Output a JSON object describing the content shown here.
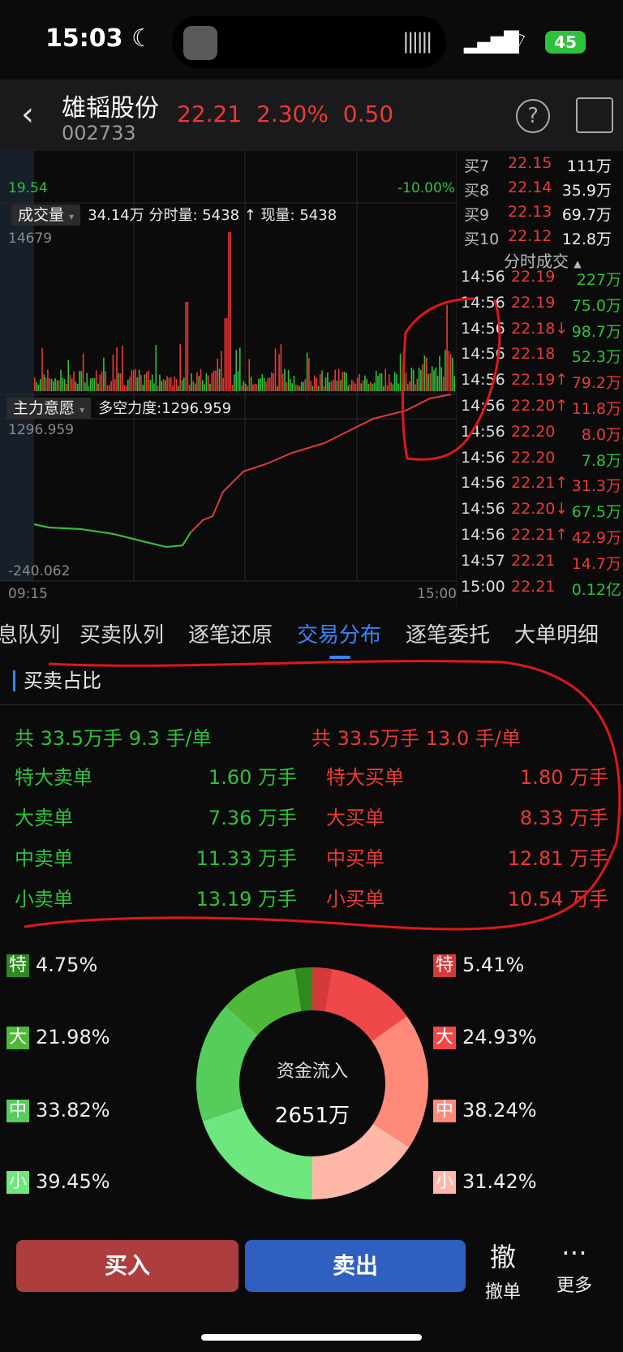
{
  "status_bar": {
    "time": "15:03",
    "battery": "45"
  },
  "header": {
    "name": "雄韬股份",
    "code": "002733",
    "price": "22.21",
    "change_pct": "2.30%",
    "change": "0.50"
  },
  "chart": {
    "top_left": "19.54",
    "top_right": "-10.00%",
    "volume_tag": "成交量",
    "volume_info": "34.14万 分时量: 5438 ↑ 现量: 5438",
    "volume_max": "14679",
    "force_tag": "主力意愿",
    "force_info": "多空力度:1296.959",
    "force_max": "1296.959",
    "force_min": "-240.062",
    "time_start": "09:15",
    "time_end": "15:00"
  },
  "order_book": [
    {
      "label": "买7",
      "price": "22.15",
      "vol": "111万"
    },
    {
      "label": "买8",
      "price": "22.14",
      "vol": "35.9万"
    },
    {
      "label": "买9",
      "price": "22.13",
      "vol": "69.7万"
    },
    {
      "label": "买10",
      "price": "22.12",
      "vol": "12.8万"
    }
  ],
  "trades_title": "分时成交",
  "trades": [
    {
      "time": "14:56",
      "price": "22.19",
      "vol": "227万",
      "pc": "red",
      "vc": "green"
    },
    {
      "time": "14:56",
      "price": "22.19",
      "vol": "75.0万",
      "pc": "red",
      "vc": "green"
    },
    {
      "time": "14:56",
      "price": "22.18↓",
      "vol": "98.7万",
      "pc": "red",
      "vc": "green"
    },
    {
      "time": "14:56",
      "price": "22.18",
      "vol": "52.3万",
      "pc": "red",
      "vc": "green"
    },
    {
      "time": "14:56",
      "price": "22.19↑",
      "vol": "79.2万",
      "pc": "red",
      "vc": "red"
    },
    {
      "time": "14:56",
      "price": "22.20↑",
      "vol": "11.8万",
      "pc": "red",
      "vc": "red"
    },
    {
      "time": "14:56",
      "price": "22.20",
      "vol": "8.0万",
      "pc": "red",
      "vc": "red"
    },
    {
      "time": "14:56",
      "price": "22.20",
      "vol": "7.8万",
      "pc": "red",
      "vc": "green"
    },
    {
      "time": "14:56",
      "price": "22.21↑",
      "vol": "31.3万",
      "pc": "red",
      "vc": "red"
    },
    {
      "time": "14:56",
      "price": "22.20↓",
      "vol": "67.5万",
      "pc": "red",
      "vc": "green"
    },
    {
      "time": "14:56",
      "price": "22.21↑",
      "vol": "42.9万",
      "pc": "red",
      "vc": "red"
    },
    {
      "time": "14:57",
      "price": "22.21",
      "vol": "14.7万",
      "pc": "red",
      "vc": "red"
    },
    {
      "time": "15:00",
      "price": "22.21",
      "vol": "0.12亿",
      "pc": "red",
      "vc": "green"
    }
  ],
  "tabs": [
    "息队列",
    "买卖队列",
    "逐笔还原",
    "交易分布",
    "逐笔委托",
    "大单明细"
  ],
  "active_tab": "交易分布",
  "section": {
    "title": "买卖占比",
    "sell_total": "共 33.5万手  9.3 手/单",
    "buy_total": "共 33.5万手  13.0 手/单",
    "rows": [
      {
        "sell_label": "特大卖单",
        "sell_val": "1.60 万手",
        "buy_label": "特大买单",
        "buy_val": "1.80 万手"
      },
      {
        "sell_label": "大卖单",
        "sell_val": "7.36 万手",
        "buy_label": "大买单",
        "buy_val": "8.33 万手"
      },
      {
        "sell_label": "中卖单",
        "sell_val": "11.33 万手",
        "buy_label": "中买单",
        "buy_val": "12.81 万手"
      },
      {
        "sell_label": "小卖单",
        "sell_val": "13.19 万手",
        "buy_label": "小买单",
        "buy_val": "10.54 万手"
      }
    ]
  },
  "donut": {
    "center_title": "资金流入",
    "center_value": "2651万",
    "sell": [
      {
        "tag": "特",
        "pct": "4.75%",
        "value": 4.75,
        "color": "#2c8a1f"
      },
      {
        "tag": "大",
        "pct": "21.98%",
        "value": 21.98,
        "color": "#4fb838"
      },
      {
        "tag": "中",
        "pct": "33.82%",
        "value": 33.82,
        "color": "#56cc5a"
      },
      {
        "tag": "小",
        "pct": "39.45%",
        "value": 39.45,
        "color": "#6ee87e"
      }
    ],
    "buy": [
      {
        "tag": "特",
        "pct": "5.41%",
        "value": 5.41,
        "color": "#d33b3b"
      },
      {
        "tag": "大",
        "pct": "24.93%",
        "value": 24.93,
        "color": "#f04848"
      },
      {
        "tag": "中",
        "pct": "38.24%",
        "value": 38.24,
        "color": "#ff8a7a"
      },
      {
        "tag": "小",
        "pct": "31.42%",
        "value": 31.42,
        "color": "#ffb8a8"
      }
    ]
  },
  "bottom": {
    "buy": "买入",
    "sell": "卖出",
    "cancel_icon": "撤",
    "cancel": "撤单",
    "more_icon": "⋯",
    "more": "更多"
  },
  "colors": {
    "up": "#ea3a36",
    "down": "#2ec23a",
    "accent": "#3c82f6"
  }
}
